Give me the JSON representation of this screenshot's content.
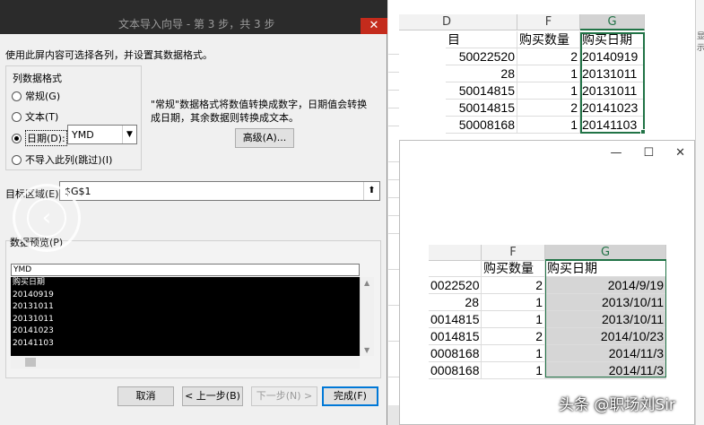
{
  "dialog": {
    "title": "文本导入向导 - 第 3 步，共 3 步",
    "close": "✕",
    "instruction": "使用此屏内容可选择各列，并设置其数据格式。",
    "format_group_title": "列数据格式",
    "options": {
      "general": "常规(G)",
      "text": "文本(T)",
      "date": "日期(D):",
      "skip": "不导入此列(跳过)(I)"
    },
    "date_format_value": "YMD",
    "general_note": "\"常规\"数据格式将数值转换成数字，日期值会转换成日期，其余数据则转换成文本。",
    "advanced_button": "高级(A)...",
    "destination_label": "目标区域(E):",
    "destination_value": "$G$1",
    "preview_label": "数据预览(P)",
    "preview_header": "YMD",
    "preview_rows": [
      "购买日期",
      "20140919",
      "20131011",
      "20131011",
      "20141023",
      "20141103"
    ],
    "buttons": {
      "cancel": "取消",
      "back": "< 上一步(B)",
      "next": "下一步(N) >",
      "finish": "完成(F)"
    }
  },
  "sheet_top": {
    "columns": [
      "D",
      "F",
      "G"
    ],
    "header_row": [
      "目",
      "购买数量",
      "购买日期"
    ],
    "rows": [
      [
        "50022520",
        "2",
        "20140919"
      ],
      [
        "28",
        "1",
        "20131011"
      ],
      [
        "50014815",
        "1",
        "20131011"
      ],
      [
        "50014815",
        "2",
        "20141023"
      ],
      [
        "50008168",
        "1",
        "20141103"
      ]
    ]
  },
  "sheet_bottom": {
    "window_controls": [
      "—",
      "☐",
      "✕"
    ],
    "columns": [
      "F",
      "G"
    ],
    "header_row": [
      "",
      "购买数量",
      "购买日期"
    ],
    "rows": [
      [
        "0022520",
        "2",
        "2014/9/19"
      ],
      [
        "28",
        "1",
        "2013/10/11"
      ],
      [
        "0014815",
        "1",
        "2013/10/11"
      ],
      [
        "0014815",
        "2",
        "2014/10/23"
      ],
      [
        "0008168",
        "1",
        "2014/11/3"
      ],
      [
        "0008168",
        "1",
        "2014/11/3"
      ]
    ]
  },
  "right_edge_text": "显示",
  "watermark": "头条 @职场刘Sir",
  "colors": {
    "excel_green": "#217346",
    "selection_gray": "#d6d6d6",
    "preview_black": "#000000"
  }
}
